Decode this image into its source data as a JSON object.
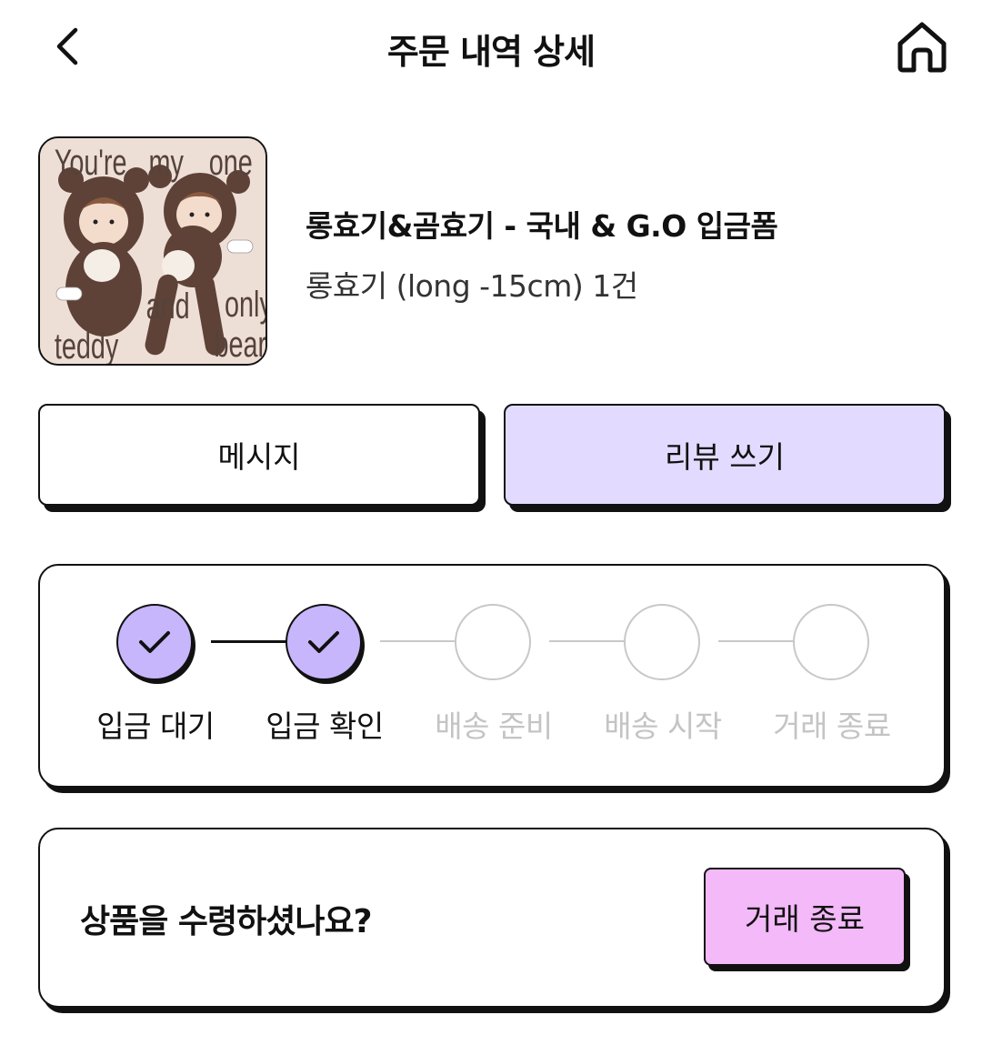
{
  "header": {
    "title": "주문 내역 상세",
    "back_icon": "chevron-left-icon",
    "home_icon": "home-icon"
  },
  "product": {
    "image_text": [
      "You're",
      "my",
      "one",
      "and",
      "only",
      "teddy",
      "bear."
    ],
    "name": "롱효기&곰효기 - 국내 & G.O 입금폼",
    "option": "롱효기 (long -15cm) 1건"
  },
  "actions": {
    "message_label": "메시지",
    "review_label": "리뷰 쓰기"
  },
  "progress": {
    "steps": [
      {
        "label": "입금 대기",
        "done": true
      },
      {
        "label": "입금 확인",
        "done": true
      },
      {
        "label": "배송 준비",
        "done": false
      },
      {
        "label": "배송 시작",
        "done": false
      },
      {
        "label": "거래 종료",
        "done": false
      }
    ]
  },
  "receipt": {
    "question": "상품을 수령하셨나요?",
    "complete_label": "거래 종료"
  },
  "colors": {
    "review_button": "#e3dbff",
    "step_done": "#c7b6fb",
    "complete_button": "#f3b9f8",
    "step_todo_text": "#c4c4c4"
  }
}
